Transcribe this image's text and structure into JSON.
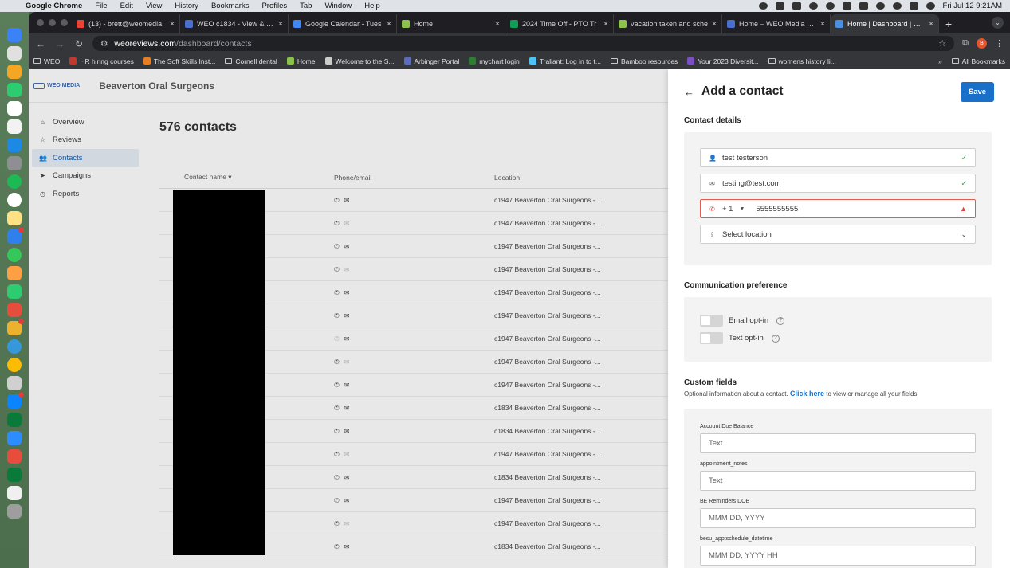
{
  "menubar": {
    "app": "Google Chrome",
    "items": [
      "File",
      "Edit",
      "View",
      "History",
      "Bookmarks",
      "Profiles",
      "Tab",
      "Window",
      "Help"
    ],
    "clock": "Fri Jul 12  9:21AM"
  },
  "tabs": [
    {
      "title": "(13) - brett@weomedia.",
      "color": "#ea4335"
    },
    {
      "title": "WEO c1834 - View & Ed",
      "color": "#4a6fd1"
    },
    {
      "title": "Google Calendar - Tues",
      "color": "#4285f4"
    },
    {
      "title": "Home",
      "color": "#8bc34a"
    },
    {
      "title": "2024 Time Off - PTO Tr",
      "color": "#0f9d58"
    },
    {
      "title": "vacation taken and sche",
      "color": "#8bc34a"
    },
    {
      "title": "Home – WEO Media – Z",
      "color": "#4a6fd1"
    },
    {
      "title": "Home | Dashboard | Bus",
      "color": "#4a90e2",
      "active": true
    }
  ],
  "address": {
    "host": "weoreviews.com",
    "path": "/dashboard/contacts"
  },
  "bookmarks": [
    {
      "label": "WEO",
      "type": "folder"
    },
    {
      "label": "HR hiring courses",
      "type": "icon",
      "color": "#c0392b"
    },
    {
      "label": "The Soft Skills Inst...",
      "type": "icon",
      "color": "#e67e22"
    },
    {
      "label": "Cornell dental",
      "type": "folder"
    },
    {
      "label": "Home",
      "type": "icon",
      "color": "#8bc34a"
    },
    {
      "label": "Welcome to the S...",
      "type": "icon",
      "color": "#cccccc"
    },
    {
      "label": "Arbinger Portal",
      "type": "icon",
      "color": "#5b6bc0"
    },
    {
      "label": "mychart login",
      "type": "icon",
      "color": "#2e7d32"
    },
    {
      "label": "Traliant: Log in to t...",
      "type": "icon",
      "color": "#4fc3f7"
    },
    {
      "label": "Bamboo resources",
      "type": "folder"
    },
    {
      "label": "Your 2023 Diversit...",
      "type": "icon",
      "color": "#7b4fc3"
    },
    {
      "label": "womens history li...",
      "type": "folder"
    }
  ],
  "bookmarks_more": "»",
  "bookmarks_all": "All Bookmarks",
  "brand": {
    "logo_text": "WEO MEDIA",
    "org_name": "Beaverton Oral Surgeons"
  },
  "sidenav": [
    {
      "label": "Overview",
      "icon": "⌂"
    },
    {
      "label": "Reviews",
      "icon": "☆"
    },
    {
      "label": "Contacts",
      "icon": "👥",
      "active": true
    },
    {
      "label": "Campaigns",
      "icon": "➤"
    },
    {
      "label": "Reports",
      "icon": "◷"
    }
  ],
  "contacts": {
    "count_label": "576 contacts",
    "columns": {
      "name": "Contact name ▾",
      "phone_email": "Phone/email",
      "location": "Location"
    },
    "rows": [
      {
        "location": "c1947 Beaverton Oral Surgeons -...",
        "email": true
      },
      {
        "location": "c1947 Beaverton Oral Surgeons -...",
        "email": false
      },
      {
        "location": "c1947 Beaverton Oral Surgeons -...",
        "email": true
      },
      {
        "location": "c1947 Beaverton Oral Surgeons -...",
        "email": false
      },
      {
        "location": "c1947 Beaverton Oral Surgeons -...",
        "email": true
      },
      {
        "location": "c1947 Beaverton Oral Surgeons -...",
        "email": true
      },
      {
        "location": "c1947 Beaverton Oral Surgeons -...",
        "email": true,
        "phone_off": true
      },
      {
        "location": "c1947 Beaverton Oral Surgeons -...",
        "email": false
      },
      {
        "location": "c1947 Beaverton Oral Surgeons -...",
        "email": true
      },
      {
        "location": "c1834 Beaverton Oral Surgeons -...",
        "email": true
      },
      {
        "location": "c1834 Beaverton Oral Surgeons -...",
        "email": true
      },
      {
        "location": "c1947 Beaverton Oral Surgeons -...",
        "email": false
      },
      {
        "location": "c1834 Beaverton Oral Surgeons -...",
        "email": true
      },
      {
        "location": "c1947 Beaverton Oral Surgeons -...",
        "email": true
      },
      {
        "location": "c1947 Beaverton Oral Surgeons -...",
        "email": false
      },
      {
        "location": "c1834 Beaverton Oral Surgeons -...",
        "email": true
      }
    ]
  },
  "panel": {
    "title": "Add a contact",
    "save_label": "Save",
    "contact_details": {
      "heading": "Contact details",
      "name_value": "test testerson",
      "email_value": "testing@test.com",
      "country_code": "+ 1",
      "phone_value": "5555555555",
      "location_placeholder": "Select location"
    },
    "communication": {
      "heading": "Communication preference",
      "email_optin": "Email opt-in",
      "text_optin": "Text opt-in"
    },
    "custom_fields": {
      "heading": "Custom fields",
      "desc_prefix": "Optional information about a contact. ",
      "link_text": "Click here",
      "desc_suffix": " to view or manage all your fields.",
      "fields": [
        {
          "label": "Account Due Balance",
          "placeholder": "Text"
        },
        {
          "label": "appointment_notes",
          "placeholder": "Text"
        },
        {
          "label": "BE Reminders DOB",
          "placeholder": "MMM DD, YYYY"
        },
        {
          "label": "besu_apptschedule_datetime",
          "placeholder": "MMM DD, YYYY HH"
        }
      ]
    }
  }
}
